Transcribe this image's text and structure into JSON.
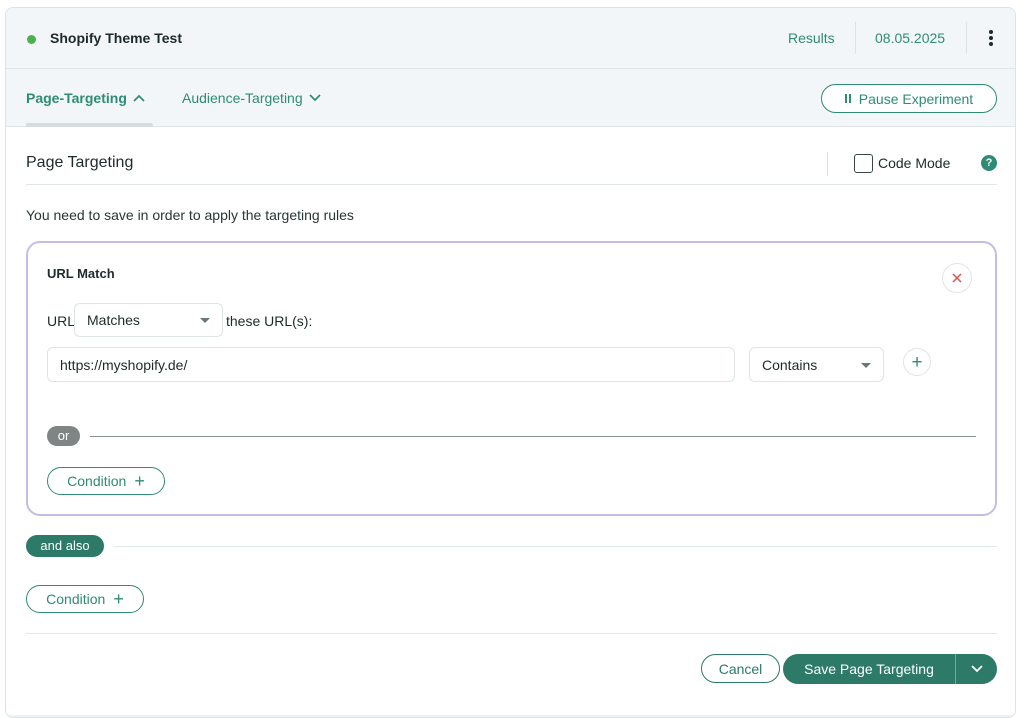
{
  "colors": {
    "accent": "#2f8c74",
    "accent_dark": "#2d7a68",
    "status_green": "#4caf50",
    "remove_red": "#d9534f"
  },
  "header": {
    "experiment_title": "Shopify Theme Test",
    "results_label": "Results",
    "date": "08.05.2025",
    "more_icon": "kebab-vertical-icon"
  },
  "tabs": [
    {
      "label": "Page-Targeting",
      "icon": "chevron-up-icon",
      "active": true
    },
    {
      "label": "Audience-Targeting",
      "icon": "chevron-down-icon",
      "active": false
    }
  ],
  "pause_button": {
    "label": "Pause Experiment",
    "icon": "pause-icon"
  },
  "section": {
    "title": "Page Targeting",
    "code_mode_label": "Code Mode",
    "code_mode_checked": false,
    "help_icon": "question-circle-icon",
    "hint": "You need to save in order to apply the targeting rules"
  },
  "url_match": {
    "title": "URL Match",
    "url_label": "URL",
    "match_mode": "Matches",
    "these_urls_label": "these URL(s):",
    "url_value": "https://myshopify.de/",
    "operator": "Contains",
    "or_label": "or",
    "condition_button_label": "Condition"
  },
  "and_also_label": "and also",
  "outer_condition_button_label": "Condition",
  "footer": {
    "cancel_label": "Cancel",
    "save_label": "Save Page Targeting"
  }
}
